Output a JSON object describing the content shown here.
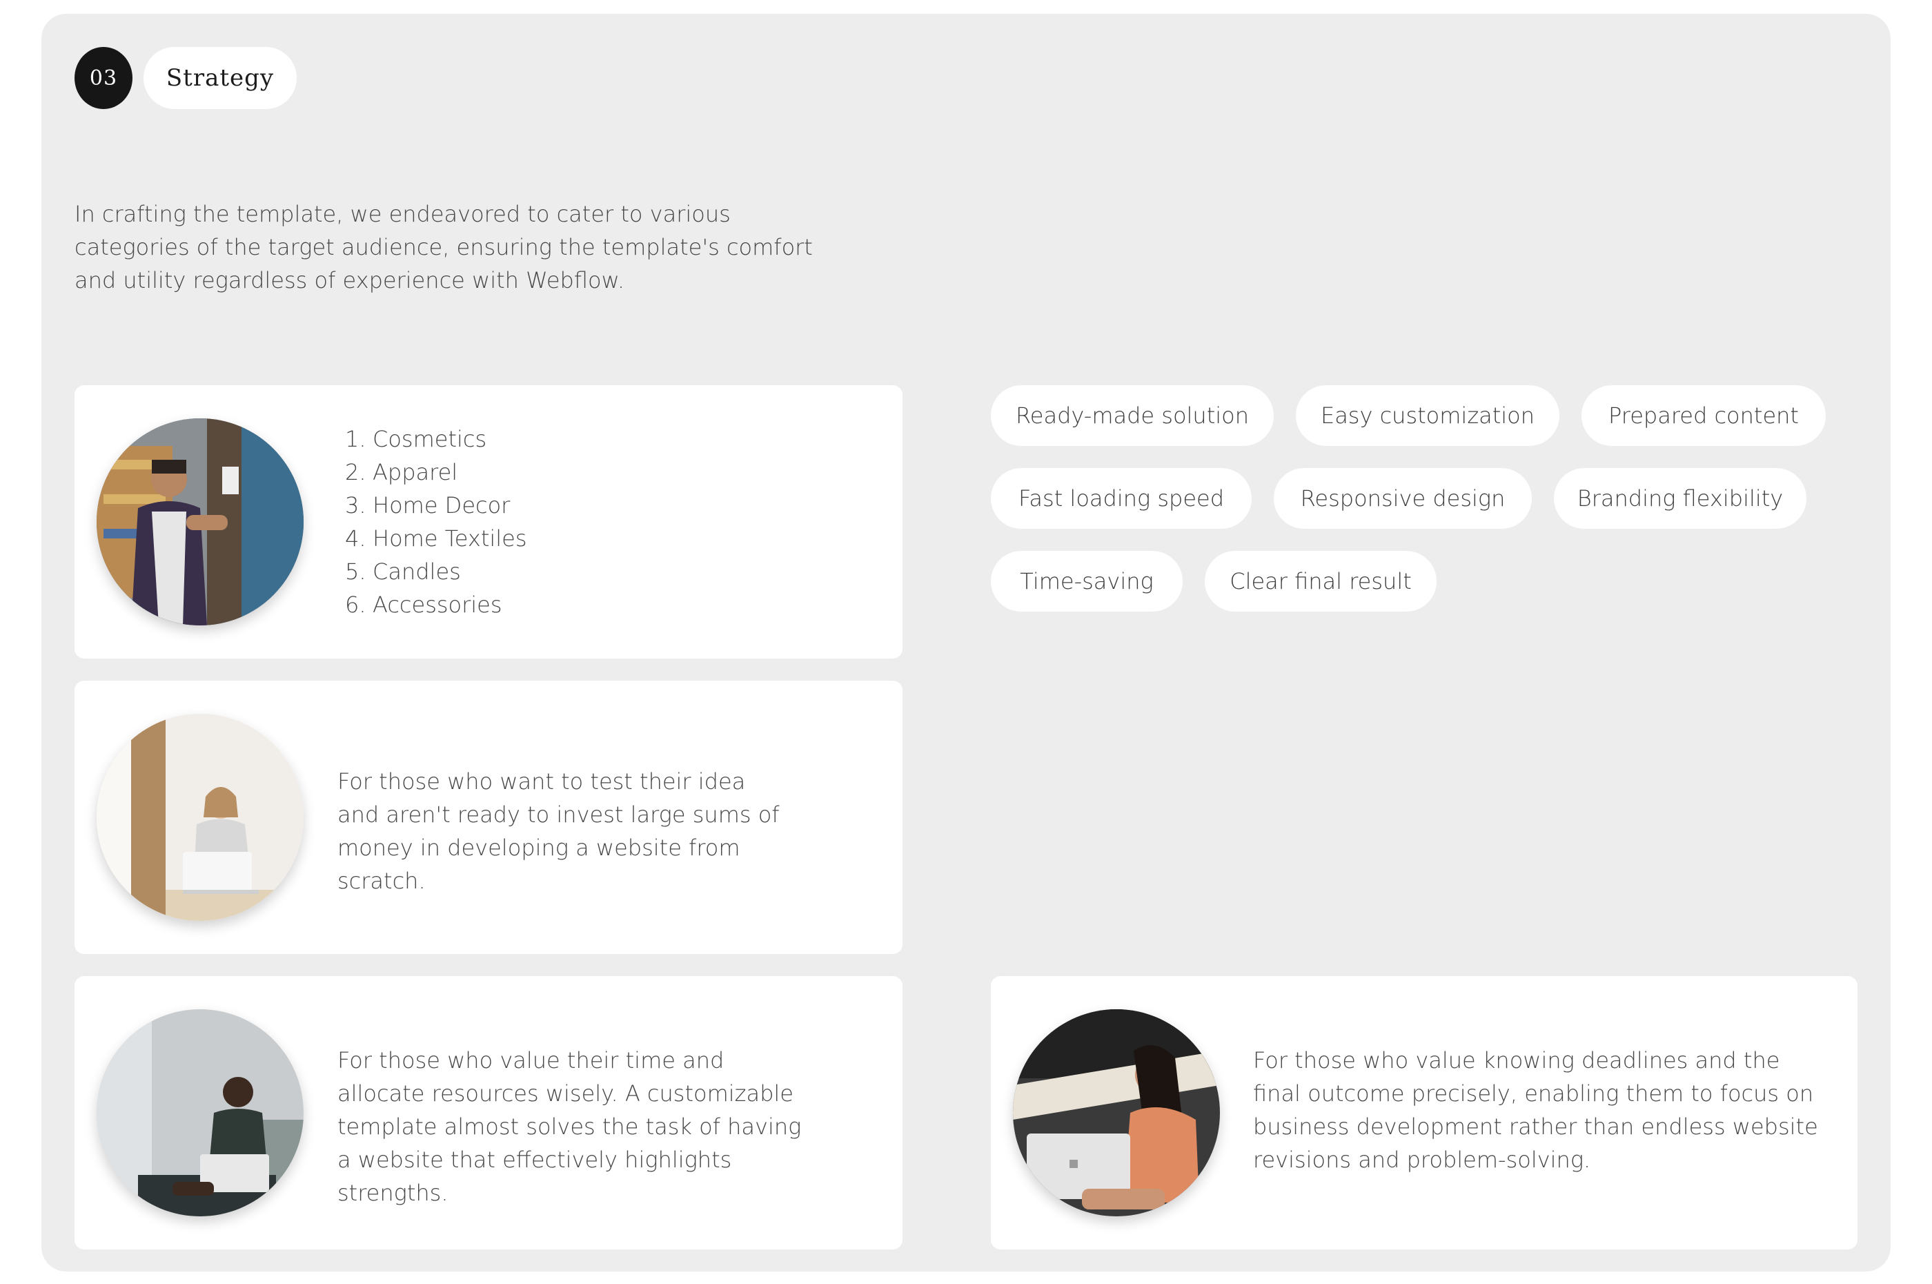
{
  "header": {
    "number": "03",
    "title": "Strategy"
  },
  "intro": "In crafting the template, we endeavored to cater to various categories of the target audience, ensuring the template's comfort and utility regardless of experience with Webflow.",
  "categories": [
    {
      "index": "1.",
      "label": "Cosmetics"
    },
    {
      "index": "2.",
      "label": "Apparel"
    },
    {
      "index": "3.",
      "label": "Home Decor"
    },
    {
      "index": "4.",
      "label": "Home Textiles"
    },
    {
      "index": "5.",
      "label": "Candles"
    },
    {
      "index": "6.",
      "label": "Accessories"
    }
  ],
  "cards": {
    "test_idea": "For those who want to test their idea and aren't ready to invest large sums of money in developing a website from scratch.",
    "value_time": "For those who value their time and allocate resources wisely. A customizable template almost solves the task of having a website that effectively highlights strengths.",
    "deadlines": "For those who value knowing deadlines and the final outcome precisely, enabling them to focus on business development rather than endless website revisions and problem-solving."
  },
  "features": [
    "Ready-made solution",
    "Easy customization",
    "Prepared content",
    "Fast loading speed",
    "Responsive design",
    "Branding flexibility",
    "Time-saving",
    "Clear final result"
  ],
  "colors": {
    "panel": "#ededed",
    "card": "#ffffff",
    "badge": "#161616",
    "text": "#474747"
  }
}
